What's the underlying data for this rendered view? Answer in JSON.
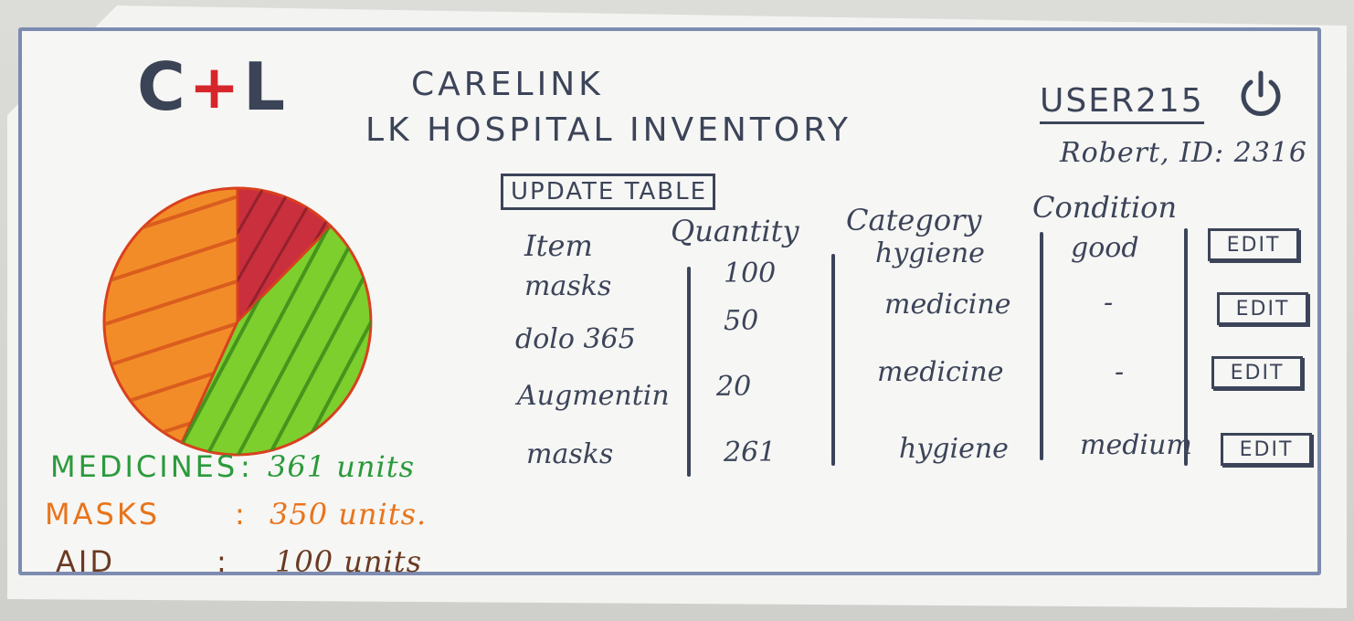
{
  "app": {
    "logo_left": "C",
    "logo_plus": "+",
    "logo_right": "L",
    "title": "CARELINK",
    "subtitle": "LK HOSPITAL INVENTORY"
  },
  "user": {
    "username": "USER215",
    "detail": "Robert, ID: 2316"
  },
  "toolbar": {
    "update_label": "UPDATE TABLE"
  },
  "colors": {
    "medicines": "#2b9a3c",
    "masks": "#e8741c",
    "aid": "#6a3a22",
    "pie_masks": "#f28c28",
    "pie_aid": "#c92f3c",
    "pie_medicines": "#7ccf2c",
    "ink": "#3c4459"
  },
  "chart_data": {
    "type": "pie",
    "slices": [
      {
        "name": "MASKS",
        "value": 350,
        "color": "#f28c28"
      },
      {
        "name": "AID",
        "value": 100,
        "color": "#c92f3c"
      },
      {
        "name": "MEDICINES",
        "value": 361,
        "color": "#7ccf2c"
      }
    ]
  },
  "legend": [
    {
      "label": "MEDICINES",
      "sep": ":",
      "value": "361 units"
    },
    {
      "label": "MASKS",
      "sep": ":",
      "value": "350 units."
    },
    {
      "label": "AID",
      "sep": ":",
      "value": "100 units"
    }
  ],
  "table": {
    "headers": [
      "Item",
      "Quantity",
      "Category",
      "Condition"
    ],
    "rows": [
      {
        "item": "masks",
        "quantity": "100",
        "category": "hygiene",
        "condition": "good",
        "action": "EDIT"
      },
      {
        "item": "dolo 365",
        "quantity": "50",
        "category": "medicine",
        "condition": "-",
        "action": "EDIT"
      },
      {
        "item": "Augmentin",
        "quantity": "20",
        "category": "medicine",
        "condition": "-",
        "action": "EDIT"
      },
      {
        "item": "masks",
        "quantity": "261",
        "category": "hygiene",
        "condition": "medium",
        "action": "EDIT"
      }
    ]
  }
}
